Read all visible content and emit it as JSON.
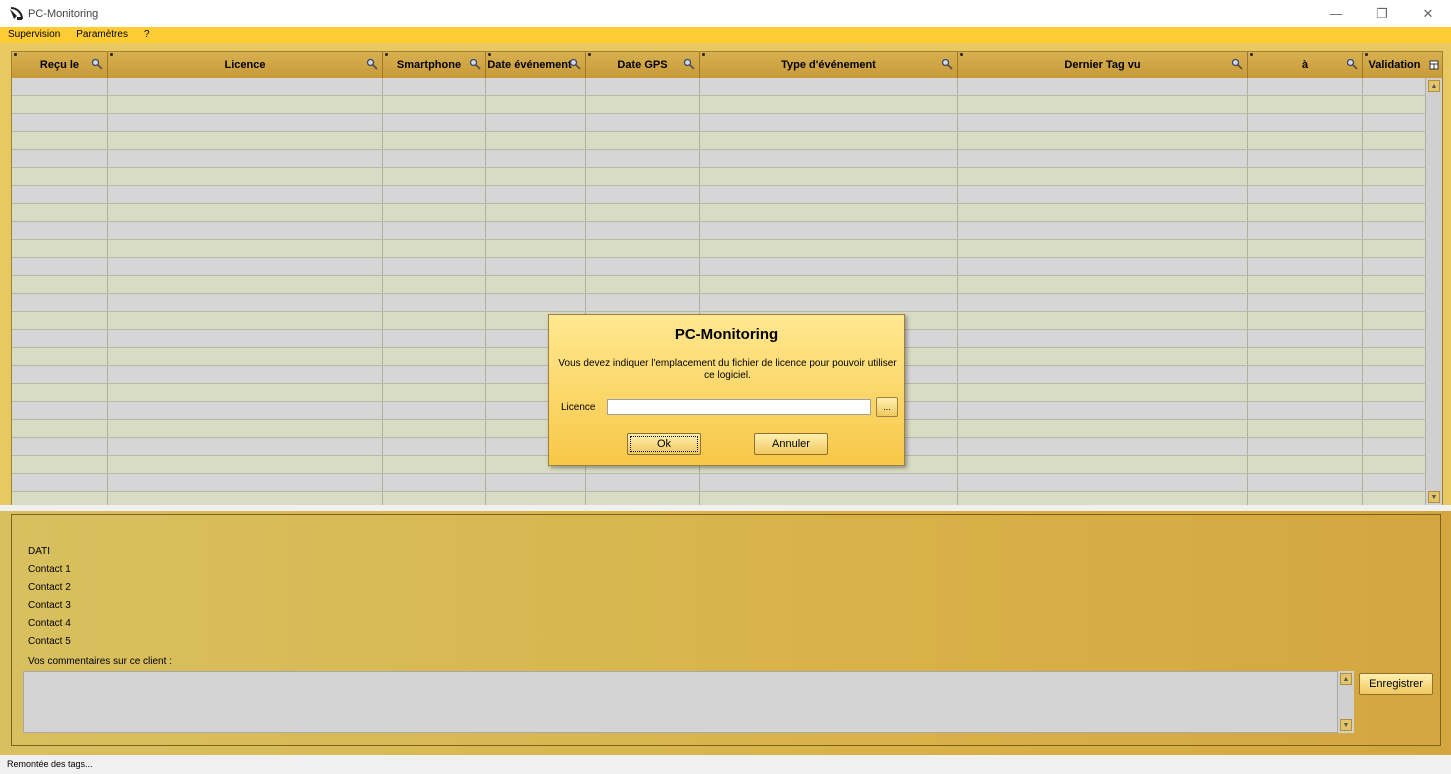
{
  "window": {
    "title": "PC-Monitoring",
    "controls": {
      "minimize": "—",
      "restore": "❐",
      "close": "✕"
    }
  },
  "menu": [
    "Supervision",
    "Paramètres",
    "?"
  ],
  "grid": {
    "columns": [
      {
        "label": "Reçu le",
        "search": true
      },
      {
        "label": "Licence",
        "search": true
      },
      {
        "label": "Smartphone",
        "search": true
      },
      {
        "label": "Date événement",
        "search": true
      },
      {
        "label": "Date GPS",
        "search": true
      },
      {
        "label": "Type d'événement",
        "search": true
      },
      {
        "label": "Dernier Tag vu",
        "search": true
      },
      {
        "label": "à",
        "search": true
      },
      {
        "label": "Validation",
        "search": false
      }
    ],
    "row_count": 24,
    "colors": {
      "row_even": "#d6d6d6",
      "row_odd": "#d9dcc4",
      "header": "#c89a38"
    }
  },
  "details": {
    "labels": [
      "DATI",
      "Contact 1",
      "Contact 2",
      "Contact 3",
      "Contact 4",
      "Contact 5"
    ],
    "comment_label": "Vos commentaires sur ce client :",
    "comment_value": "",
    "save_label": "Enregistrer"
  },
  "status": {
    "text": "Remontée des tags..."
  },
  "dialog": {
    "title": "PC-Monitoring",
    "message": "Vous devez indiquer l'emplacement du fichier de licence pour pouvoir utiliser ce logiciel.",
    "licence_label": "Licence",
    "licence_value": "",
    "browse_label": "...",
    "ok_label": "Ok",
    "cancel_label": "Annuler"
  },
  "icons": {
    "app": "satellite-dish-icon",
    "search": "magnifier-icon",
    "column_chooser": "column-chooser-icon"
  }
}
